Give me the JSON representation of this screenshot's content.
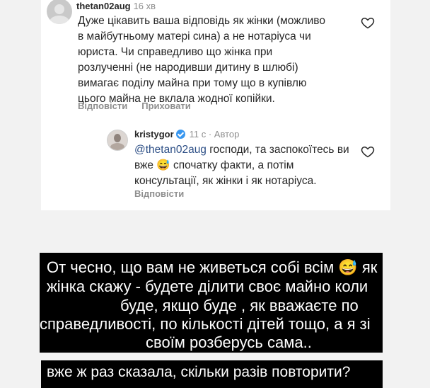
{
  "comment1": {
    "username": "thetan02aug",
    "time": "16 хв",
    "lines": [
      "Дуже цікавить ваша відповідь як жінки (можливо",
      "в майбутньому матері сина) а не нотаріуса чи",
      "юриста. Чи справедливо що жінка при",
      "розлученні (не народивши дитину в шлюбі)",
      "вимагає поділу майна при тому що в купівлю",
      "цього майна не вклала жодної копійки."
    ],
    "reply_label": "Відповісти",
    "hide_label": "Приховати"
  },
  "comment2": {
    "username": "kristygor",
    "meta": "11 с · Автор",
    "mention": "@thetan02aug",
    "line1_rest": " господи, та заспокоїтесь ви",
    "line2": "вже 😅 спочатку факти, а потім",
    "line3": "консультації, як жінки і як нотаріуса.",
    "reply_label": "Відповісти"
  },
  "caption": {
    "lines": [
      "От чесно,  що вам не живеться собі всім 😅 як",
      "жінка скажу - будете ділити своє майно коли",
      "буде, якщо буде , як вважаєте по",
      "справедливості, по кількості дітей тощо, а я зі",
      "своїм розберусь сама.."
    ],
    "second": "вже ж раз сказала, скільки разів повторити?"
  },
  "colors": {
    "mention": "#2d4f86",
    "verified": "#3897f0",
    "caption_bg": "#000000"
  },
  "icons": [
    "avatar",
    "heart-icon",
    "verified-icon"
  ]
}
